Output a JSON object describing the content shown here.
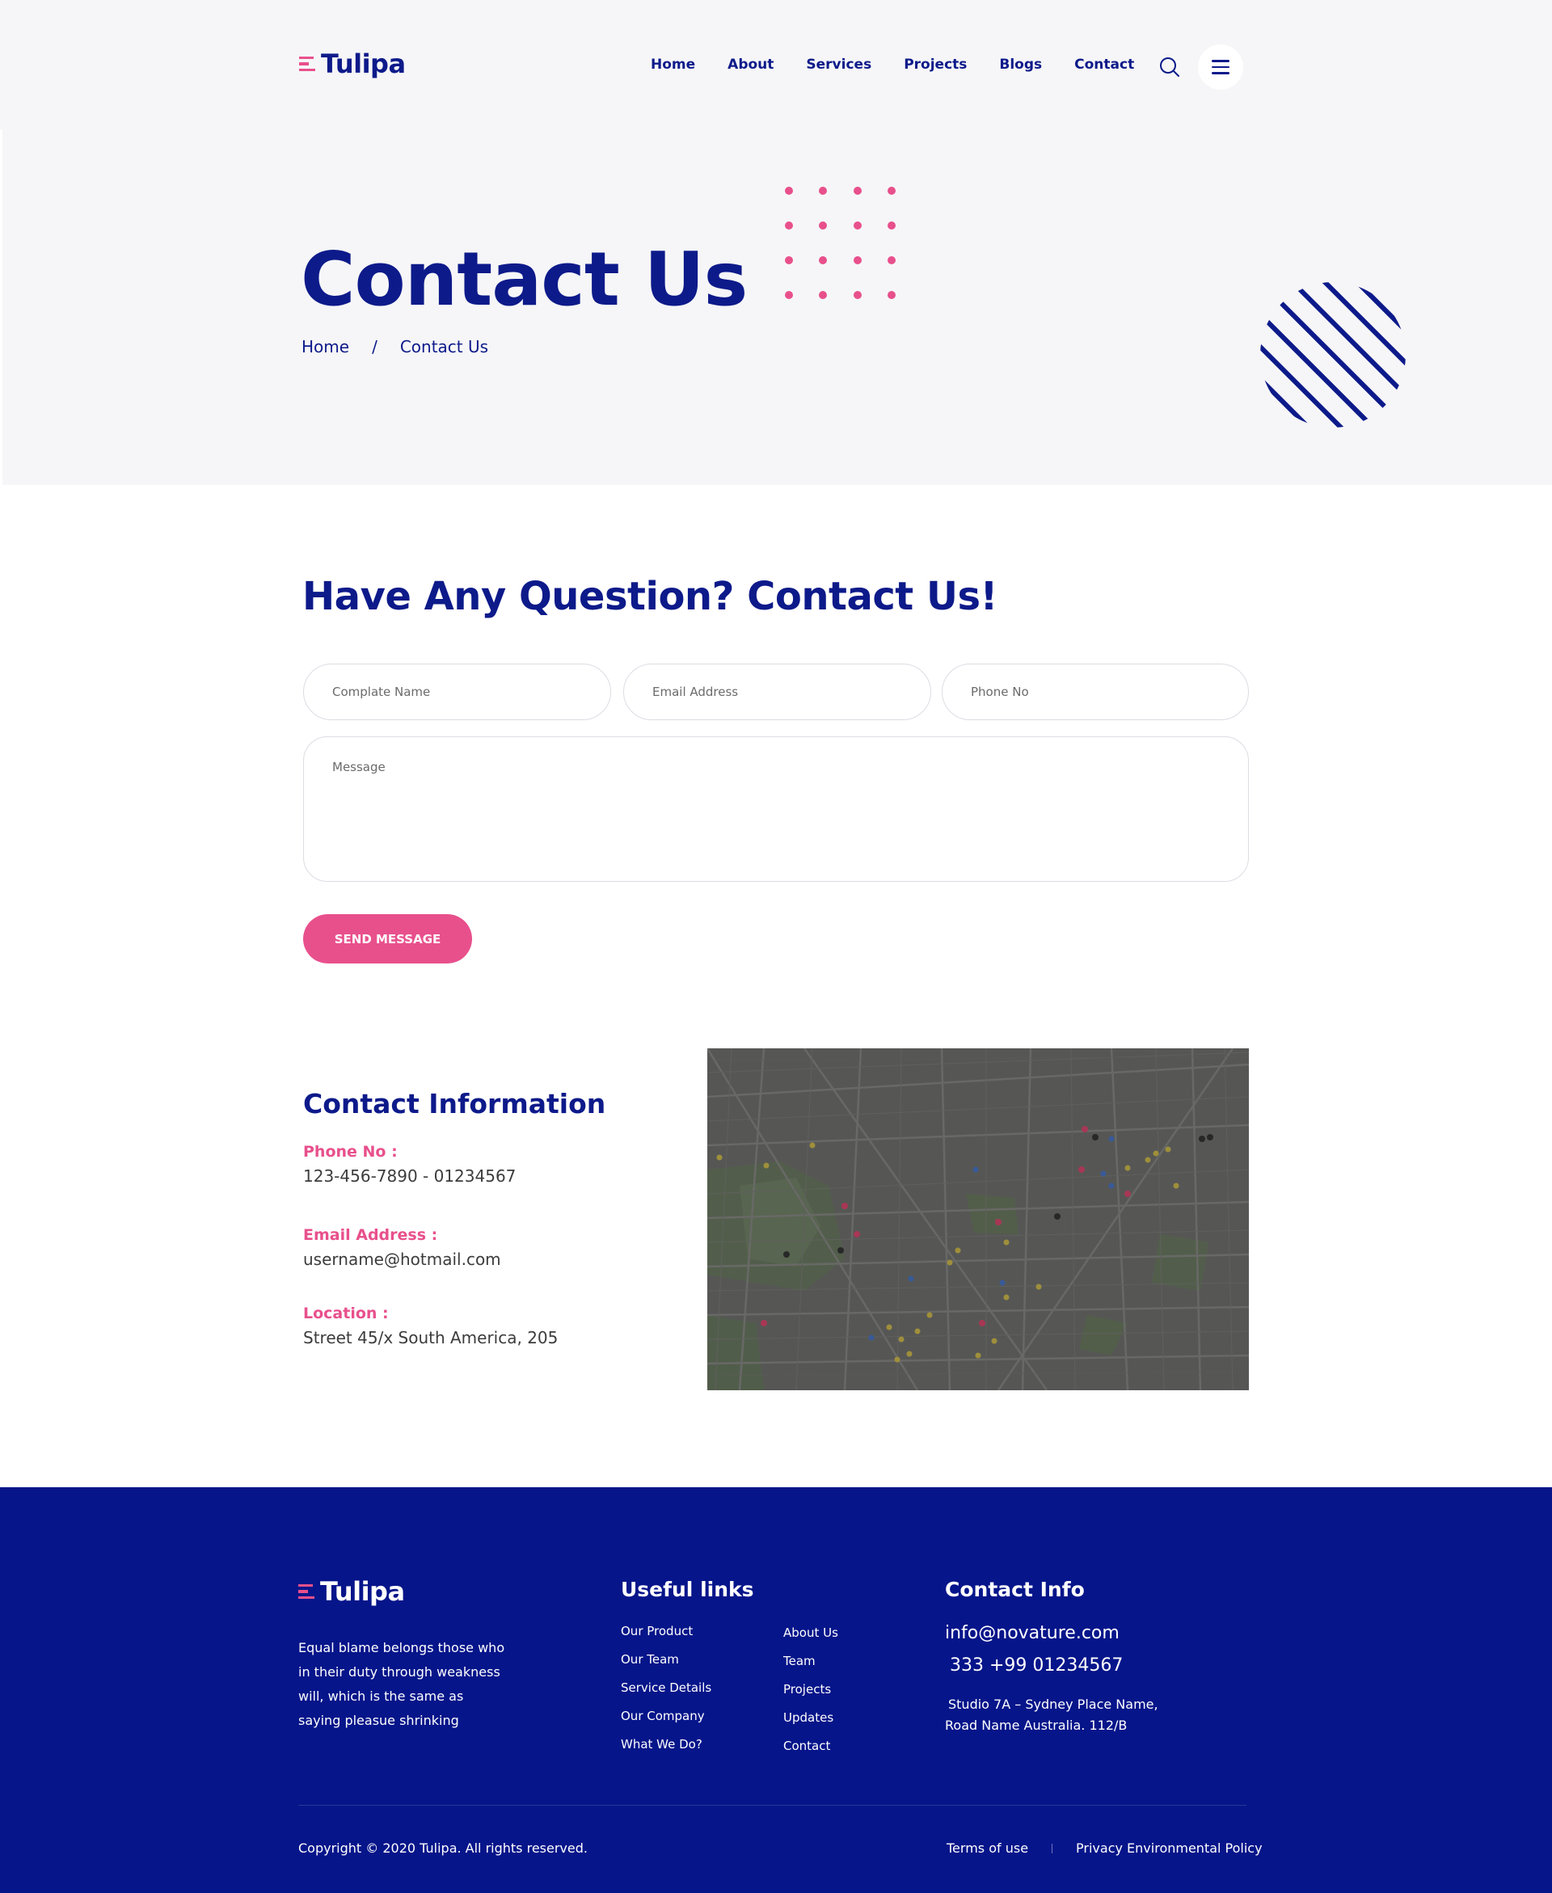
{
  "brand": {
    "name": "Tulipa",
    "accent": "#e8508c",
    "primary": "#0d1a8a",
    "footer_bg": "#06158a"
  },
  "nav": {
    "items": [
      "Home",
      "About",
      "Services",
      "Projects",
      "Blogs",
      "Contact"
    ]
  },
  "hero": {
    "title": "Contact Us",
    "breadcrumb": {
      "home": "Home",
      "separator": "/",
      "current": "Contact Us"
    }
  },
  "form": {
    "heading": "Have Any Question? Contact Us!",
    "name_placeholder": "Complate Name",
    "email_placeholder": "Email Address",
    "phone_placeholder": "Phone No",
    "message_placeholder": "Message",
    "submit_label": "SEND MESSAGE"
  },
  "contact_info": {
    "heading": "Contact Information",
    "phone_label": "Phone No :",
    "phone_value": "123-456-7890 - 01234567",
    "email_label": "Email Address :",
    "email_value": "username@hotmail.com",
    "location_label": "Location :",
    "location_value": "Street 45/x  South America, 205"
  },
  "footer": {
    "about": "Equal blame belongs those who in their duty through weakness will, which is the same as saying pleasue shrinking",
    "useful_links_heading": "Useful links",
    "links_col1": [
      "Our Product",
      "Our Team",
      "Service Details",
      "Our Company",
      "What We Do?"
    ],
    "links_col2": [
      "About Us",
      "Team",
      "Projects",
      "Updates",
      "Contact"
    ],
    "contact_heading": "Contact Info",
    "email": "info@novature.com",
    "phone": "333 +99 01234567",
    "address_line1": "Studio 7A – Sydney Place Name,",
    "address_line2": "Road Name Australia. 112/B",
    "copyright": "Copyright © 2020 Tulipa. All rights reserved.",
    "terms": "Terms of use",
    "privacy": "Privacy Environmental Policy"
  }
}
